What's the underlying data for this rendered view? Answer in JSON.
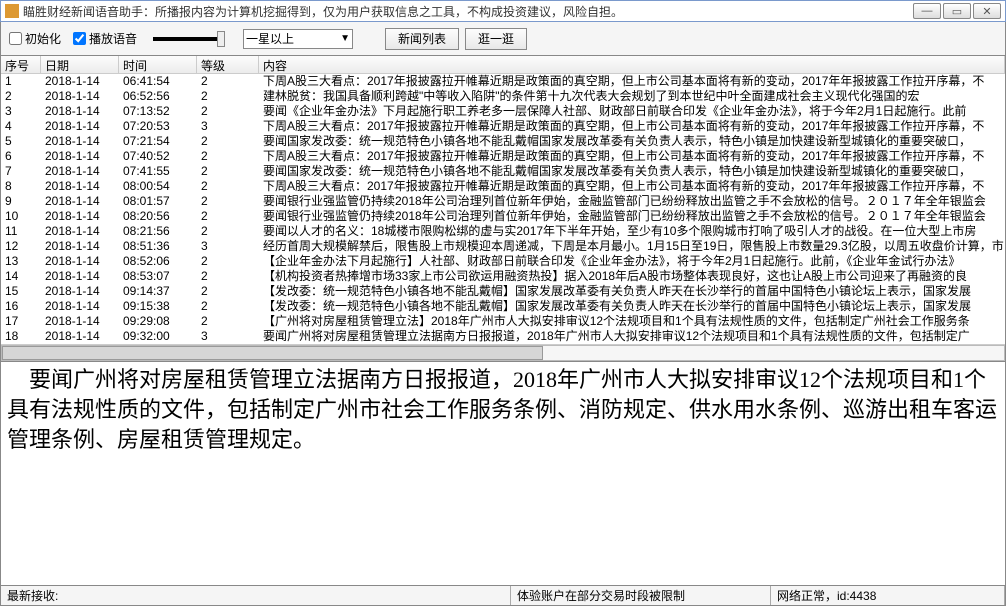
{
  "title": "瞄胜财经新闻语音助手：所播报内容为计算机挖掘得到，仅为用户获取信息之工具，不构成投资建议，风险自担。",
  "toolbar": {
    "init_label": "初始化",
    "init_checked": false,
    "play_label": "播放语音",
    "play_checked": true,
    "rating": "一星以上",
    "btn_news": "新闻列表",
    "btn_stroll": "逛一逛"
  },
  "columns": {
    "c0": "序号",
    "c1": "日期",
    "c2": "时间",
    "c3": "等级",
    "c4": "内容"
  },
  "rows": [
    {
      "n": "1",
      "d": "2018-1-14",
      "t": "06:41:54",
      "lv": "2",
      "c": "下周A股三大看点：2017年报披露拉开帷幕近期是政策面的真空期，但上市公司基本面将有新的变动，2017年年报披露工作拉开序幕，不"
    },
    {
      "n": "2",
      "d": "2018-1-14",
      "t": "06:52:56",
      "lv": "2",
      "c": "建林脱贫：我国具备顺利跨越\"中等收入陷阱\"的条件第十九次代表大会规划了到本世纪中叶全面建成社会主义现代化强国的宏"
    },
    {
      "n": "3",
      "d": "2018-1-14",
      "t": "07:13:52",
      "lv": "2",
      "c": "要闻《企业年金办法》下月起施行职工养老多一层保障人社部、财政部日前联合印发《企业年金办法》，将于今年2月1日起施行。此前"
    },
    {
      "n": "4",
      "d": "2018-1-14",
      "t": "07:20:53",
      "lv": "3",
      "c": "下周A股三大看点：2017年报披露拉开帷幕近期是政策面的真空期，但上市公司基本面将有新的变动，2017年年报披露工作拉开序幕，不"
    },
    {
      "n": "5",
      "d": "2018-1-14",
      "t": "07:21:54",
      "lv": "2",
      "c": "要闻国家发改委：统一规范特色小镇各地不能乱戴帽国家发展改革委有关负责人表示，特色小镇是加快建设新型城镇化的重要突破口，"
    },
    {
      "n": "6",
      "d": "2018-1-14",
      "t": "07:40:52",
      "lv": "2",
      "c": "下周A股三大看点：2017年报披露拉开帷幕近期是政策面的真空期，但上市公司基本面将有新的变动，2017年年报披露工作拉开序幕，不"
    },
    {
      "n": "7",
      "d": "2018-1-14",
      "t": "07:41:55",
      "lv": "2",
      "c": "要闻国家发改委：统一规范特色小镇各地不能乱戴帽国家发展改革委有关负责人表示，特色小镇是加快建设新型城镇化的重要突破口，"
    },
    {
      "n": "8",
      "d": "2018-1-14",
      "t": "08:00:54",
      "lv": "2",
      "c": "下周A股三大看点：2017年报披露拉开帷幕近期是政策面的真空期，但上市公司基本面将有新的变动，2017年年报披露工作拉开序幕，不"
    },
    {
      "n": "9",
      "d": "2018-1-14",
      "t": "08:01:57",
      "lv": "2",
      "c": "要闻银行业强监管仍持续2018年公司治理列首位新年伊始，金融监管部门已纷纷释放出监管之手不会放松的信号。２０１７年全年银监会"
    },
    {
      "n": "10",
      "d": "2018-1-14",
      "t": "08:20:56",
      "lv": "2",
      "c": "要闻银行业强监管仍持续2018年公司治理列首位新年伊始，金融监管部门已纷纷释放出监管之手不会放松的信号。２０１７年全年银监会"
    },
    {
      "n": "11",
      "d": "2018-1-14",
      "t": "08:21:56",
      "lv": "2",
      "c": "要闻以人才的名义：18城楼市限购松绑的虚与实2017年下半年开始，至少有10多个限购城市打响了吸引人才的战役。在一位大型上市房"
    },
    {
      "n": "12",
      "d": "2018-1-14",
      "t": "08:51:36",
      "lv": "3",
      "c": "经历首周大规模解禁后，限售股上市规模迎本周递减，下周是本月最小。1月15日至19日，限售股上市数量29.3亿股，以周五收盘价计算，市"
    },
    {
      "n": "13",
      "d": "2018-1-14",
      "t": "08:52:06",
      "lv": "2",
      "c": "【企业年金办法下月起施行】人社部、财政部日前联合印发《企业年金办法》，将于今年2月1日起施行。此前，《企业年金试行办法》"
    },
    {
      "n": "14",
      "d": "2018-1-14",
      "t": "08:53:07",
      "lv": "2",
      "c": "【机构投资者热捧增市场33家上市公司欲运用融资热投】据入2018年后A股市场整体表现良好，这也让A股上市公司迎来了再融资的良"
    },
    {
      "n": "15",
      "d": "2018-1-14",
      "t": "09:14:37",
      "lv": "2",
      "c": "【发改委：统一规范特色小镇各地不能乱戴帽】国家发展改革委有关负责人昨天在长沙举行的首届中国特色小镇论坛上表示，国家发展"
    },
    {
      "n": "16",
      "d": "2018-1-14",
      "t": "09:15:38",
      "lv": "2",
      "c": "【发改委：统一规范特色小镇各地不能乱戴帽】国家发展改革委有关负责人昨天在长沙举行的首届中国特色小镇论坛上表示，国家发展"
    },
    {
      "n": "17",
      "d": "2018-1-14",
      "t": "09:29:08",
      "lv": "2",
      "c": "【广州将对房屋租赁管理立法】2018年广州市人大拟安排审议12个法规项目和1个具有法规性质的文件，包括制定广州社会工作服务条"
    },
    {
      "n": "18",
      "d": "2018-1-14",
      "t": "09:32:00",
      "lv": "3",
      "c": "要闻广州将对房屋租赁管理立法据南方日报报道，2018年广州市人大拟安排审议12个法规项目和1个具有法规性质的文件，包括制定广"
    }
  ],
  "detail": "　要闻广州将对房屋租赁管理立法据南方日报报道，2018年广州市人大拟安排审议12个法规项目和1个具有法规性质的文件，包括制定广州市社会工作服务条例、消防规定、供水用水条例、巡游出租车客运管理条例、房屋租赁管理规定。",
  "status": {
    "latest": "最新接收:",
    "account": "体验账户在部分交易时段被限制",
    "network": "网络正常，id:4438"
  }
}
